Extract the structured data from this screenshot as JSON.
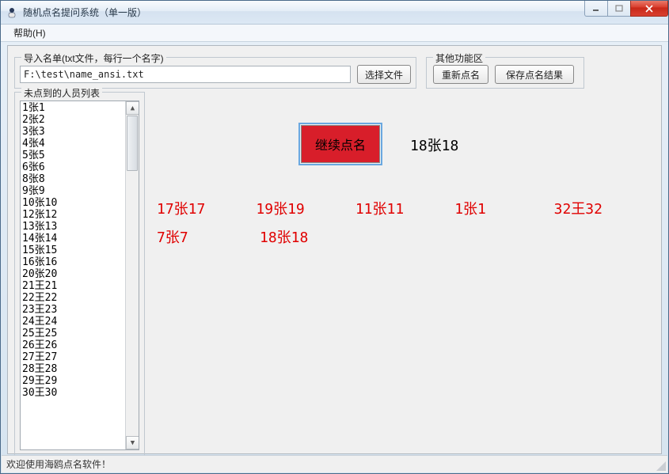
{
  "window": {
    "title": "随机点名提问系统（单一版）"
  },
  "menu": {
    "help": "帮助(H)"
  },
  "import_group": {
    "legend": "导入名单(txt文件，每行一个名字)",
    "path": "F:\\test\\name_ansi.txt",
    "choose_label": "选择文件"
  },
  "other_group": {
    "legend": "其他功能区",
    "redo_label": "重新点名",
    "save_label": "保存点名结果"
  },
  "list_group": {
    "legend": "未点到的人员列表",
    "items": [
      "1张1",
      "2张2",
      "3张3",
      "4张4",
      "5张5",
      "6张6",
      "8张8",
      "9张9",
      "10张10",
      "12张12",
      "13张13",
      "14张14",
      "15张15",
      "16张16",
      "20张20",
      "21王21",
      "22王22",
      "23王23",
      "24王24",
      "25王25",
      "26王26",
      "27王27",
      "28王28",
      "29王29",
      "30王30"
    ]
  },
  "main": {
    "button_label": "继续点名",
    "current": "18张18"
  },
  "picked": {
    "row1": [
      "17张17",
      "19张19",
      "11张11",
      "1张1",
      "32王32"
    ],
    "row2": [
      "7张7",
      "18张18"
    ]
  },
  "status": {
    "text": "欢迎使用海鸥点名软件！"
  }
}
